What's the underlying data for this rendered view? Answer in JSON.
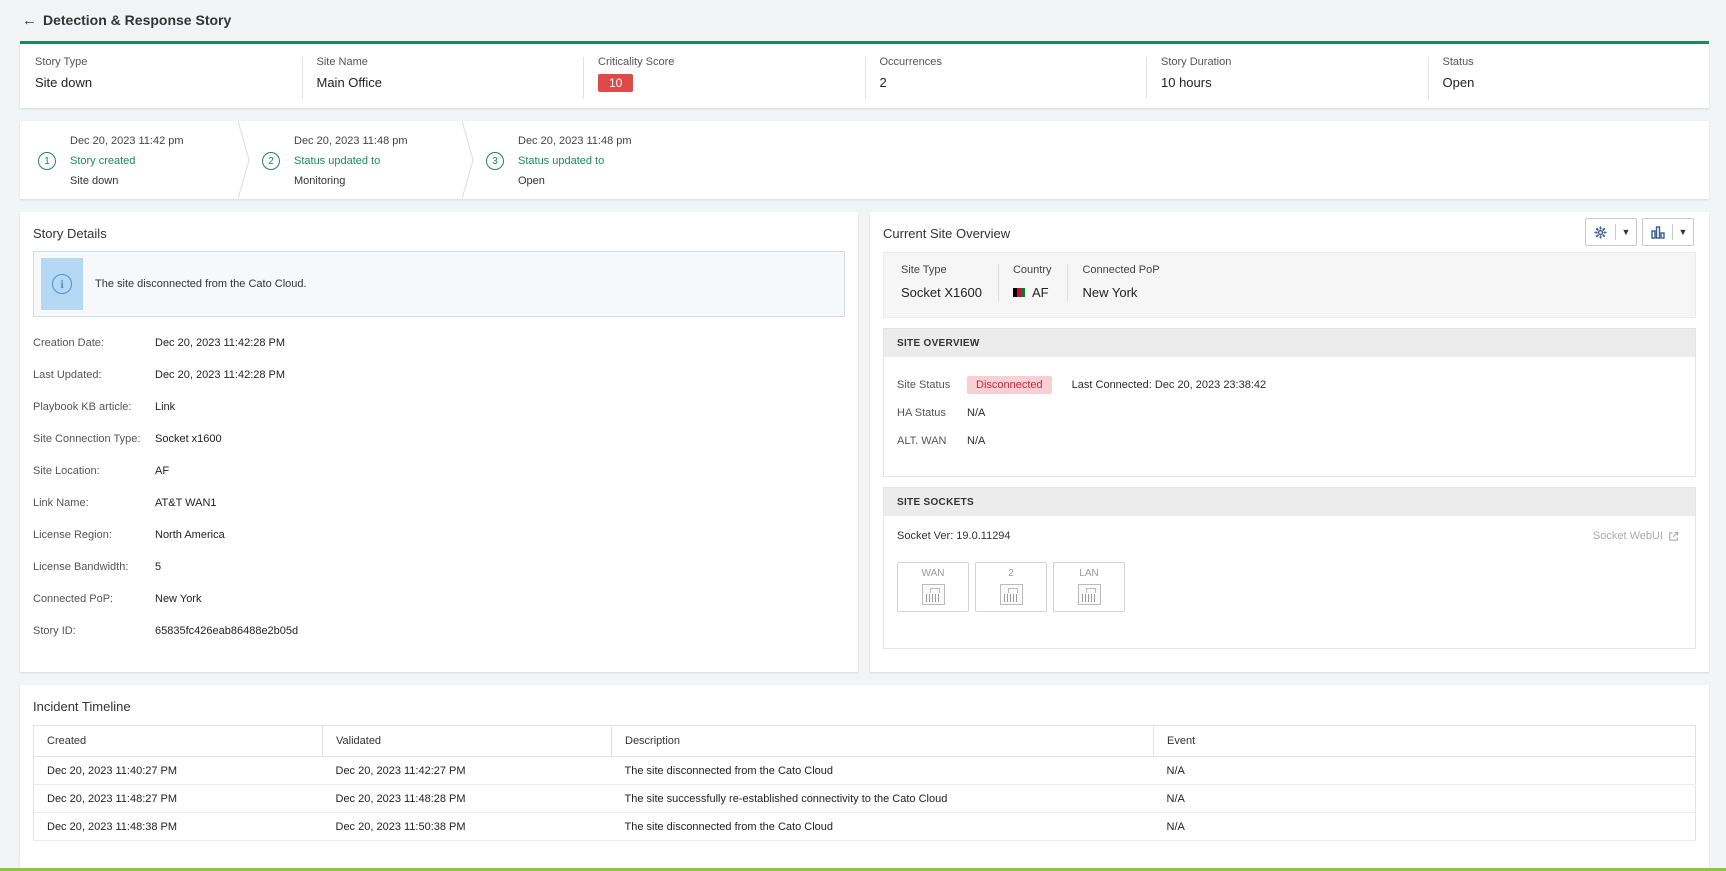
{
  "header": {
    "back_icon": "←",
    "title": "Detection & Response Story"
  },
  "summary": [
    {
      "label": "Story Type",
      "value": "Site down"
    },
    {
      "label": "Site Name",
      "value": "Main Office"
    },
    {
      "label": "Criticality Score",
      "value": "10"
    },
    {
      "label": "Occurrences",
      "value": "2"
    },
    {
      "label": "Story Duration",
      "value": "10 hours"
    },
    {
      "label": "Status",
      "value": "Open"
    }
  ],
  "steps": [
    {
      "num": "1",
      "date": "Dec 20, 2023 11:42 pm",
      "action": "Story created",
      "result": "Site down"
    },
    {
      "num": "2",
      "date": "Dec 20, 2023 11:48 pm",
      "action": "Status updated to",
      "result": "Monitoring"
    },
    {
      "num": "3",
      "date": "Dec 20, 2023 11:48 pm",
      "action": "Status updated to",
      "result": "Open"
    }
  ],
  "details": {
    "title": "Story Details",
    "info_text": "The site disconnected from the Cato Cloud.",
    "fields": [
      {
        "key": "Creation Date:",
        "value": "Dec 20, 2023 11:42:28 PM"
      },
      {
        "key": "Last Updated:",
        "value": "Dec 20, 2023 11:42:28 PM"
      },
      {
        "key": "Playbook KB article:",
        "value": "Link"
      },
      {
        "key": "Site Connection Type:",
        "value": "Socket x1600"
      },
      {
        "key": "Site Location:",
        "value": "AF"
      },
      {
        "key": "Link Name:",
        "value": "AT&T WAN1"
      },
      {
        "key": "License Region:",
        "value": "North America"
      },
      {
        "key": "License Bandwidth:",
        "value": "5"
      },
      {
        "key": "Connected PoP:",
        "value": "New York"
      },
      {
        "key": "Story ID:",
        "value": "65835fc426eab86488e2b05d"
      }
    ]
  },
  "overview": {
    "title": "Current Site Overview",
    "site_type_label": "Site Type",
    "site_type": "Socket X1600",
    "country_label": "Country",
    "country": "AF",
    "pop_label": "Connected PoP",
    "pop": "New York",
    "site_overview_title": "SITE OVERVIEW",
    "site_status_label": "Site Status",
    "site_status": "Disconnected",
    "last_connected": "Last Connected: Dec 20, 2023 23:38:42",
    "ha_label": "HA Status",
    "ha_value": "N/A",
    "altwan_label": "ALT. WAN",
    "altwan_value": "N/A",
    "sockets_title": "SITE SOCKETS",
    "socket_ver": "Socket Ver: 19.0.11294",
    "webui": "Socket WebUI",
    "ports": [
      "WAN",
      "2",
      "LAN"
    ]
  },
  "incident": {
    "title": "Incident Timeline",
    "columns": [
      "Created",
      "Validated",
      "Description",
      "Event"
    ],
    "rows": [
      [
        "Dec 20, 2023 11:40:27 PM",
        "Dec 20, 2023 11:42:27 PM",
        "The site disconnected from the Cato Cloud",
        "N/A"
      ],
      [
        "Dec 20, 2023 11:48:27 PM",
        "Dec 20, 2023 11:48:28 PM",
        "The site successfully re-established connectivity to the Cato Cloud",
        "N/A"
      ],
      [
        "Dec 20, 2023 11:48:38 PM",
        "Dec 20, 2023 11:50:38 PM",
        "The site disconnected from the Cato Cloud",
        "N/A"
      ]
    ]
  },
  "colors": {
    "accent": "#1a8a5a",
    "critical": "#de4a48",
    "disconnected_bg": "#f8d0d3",
    "bottom_bar": "#8dc63f"
  },
  "icons": {
    "back": "arrow-left-icon",
    "info": "info-icon",
    "settings": "gear-icon",
    "chart": "bar-chart-icon",
    "external": "external-link-icon",
    "flag": "afghanistan-flag-icon"
  }
}
